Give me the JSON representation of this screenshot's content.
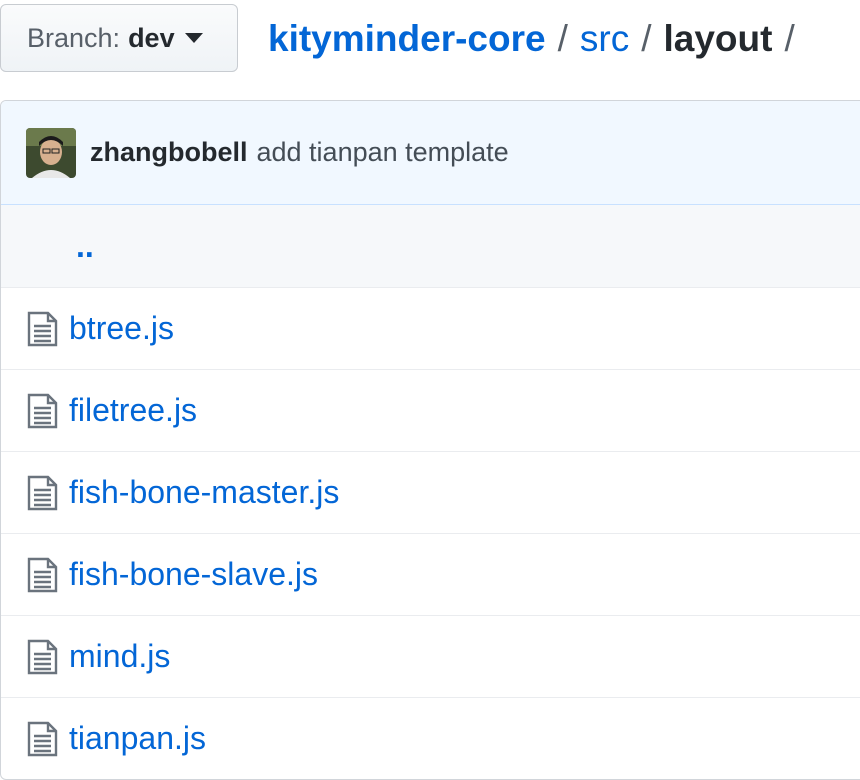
{
  "branch": {
    "label": "Branch:",
    "value": "dev"
  },
  "breadcrumb": {
    "repo": "kityminder-core",
    "separator": "/",
    "folder": "src",
    "current": "layout"
  },
  "commit": {
    "author": "zhangbobell",
    "message": "add tianpan template"
  },
  "parent_dir": "..",
  "files": [
    {
      "name": "btree.js"
    },
    {
      "name": "filetree.js"
    },
    {
      "name": "fish-bone-master.js"
    },
    {
      "name": "fish-bone-slave.js"
    },
    {
      "name": "mind.js"
    },
    {
      "name": "tianpan.js"
    }
  ],
  "colors": {
    "link": "#0366d6",
    "commit_bg": "#f1f8ff",
    "up_row_bg": "#f6f8fa"
  },
  "icons": {
    "file": "file-text-icon",
    "caret": "caret-down-icon",
    "avatar": "user-avatar"
  }
}
